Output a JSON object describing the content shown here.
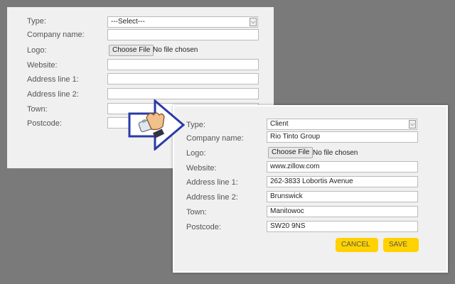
{
  "before": {
    "type_label": "Type:",
    "type_value": "---Select---",
    "company_label": "Company name:",
    "logo_label": "Logo:",
    "file_button": "Choose File",
    "file_status": "No file chosen",
    "website_label": "Website:",
    "address1_label": "Address line 1:",
    "address2_label": "Address line 2:",
    "town_label": "Town:",
    "postcode_label": "Postcode:"
  },
  "after": {
    "type_label": "Type:",
    "type_value": "Client",
    "company_label": "Company name:",
    "company_value": "Rio Tinto Group",
    "logo_label": "Logo:",
    "file_button": "Choose File",
    "file_status": "No file chosen",
    "website_label": "Website:",
    "website_value": "www.zillow.com",
    "address1_label": "Address line 1:",
    "address1_value": "262-3833 Lobortis Avenue",
    "address2_label": "Address line 2:",
    "address2_value": "Brunswick",
    "town_label": "Town:",
    "town_value": "Manitowoc",
    "postcode_label": "Postcode:",
    "postcode_value": "SW20 9NS",
    "cancel_label": "CANCEL",
    "save_label": "SAVE"
  },
  "colors": {
    "background": "#7a7a7a",
    "panel": "#f0f0f0",
    "button_yellow": "#ffd200",
    "arrow_border": "#2a3aa8"
  },
  "icons": [
    "arrow-right-icon",
    "hand-typing-icon",
    "dropdown-arrow-icon"
  ]
}
